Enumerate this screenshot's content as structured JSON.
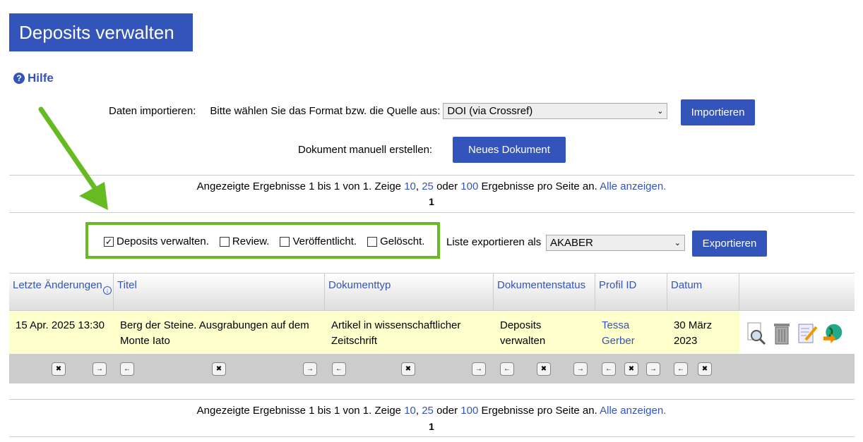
{
  "page_title": "Deposits verwalten",
  "help_label": "Hilfe",
  "import": {
    "label": "Daten importieren:",
    "select_label": "Bitte wählen Sie das Format bzw. die Quelle aus:",
    "select_value": "DOI (via Crossref)",
    "button": "Importieren"
  },
  "manual": {
    "label": "Dokument manuell erstellen:",
    "button": "Neues Dokument"
  },
  "results": {
    "prefix": "Angezeigte Ergebnisse 1 bis 1 von 1. Zeige",
    "opt10": "10",
    "sep1": ",",
    "opt25": "25",
    "oder": "oder",
    "opt100": "100",
    "suffix": "Ergebnisse pro Seite an.",
    "all": "Alle anzeigen.",
    "page": "1"
  },
  "filters": [
    {
      "label": "Deposits verwalten.",
      "checked": true
    },
    {
      "label": "Review.",
      "checked": false
    },
    {
      "label": "Veröffentlicht.",
      "checked": false
    },
    {
      "label": "Gelöscht.",
      "checked": false
    }
  ],
  "export": {
    "label": "Liste exportieren als",
    "select_value": "AKABER",
    "button": "Exportieren"
  },
  "table": {
    "headers": [
      "Letzte Änderungen",
      "Titel",
      "Dokumenttyp",
      "Dokumentenstatus",
      "Profil ID",
      "Datum"
    ],
    "row": {
      "changed": "15 Apr. 2025 13:30",
      "title": "Berg der Steine. Ausgrabungen auf dem Monte Iato",
      "type": "Artikel in wissenschaftlicher Zeitschrift",
      "status": "Deposits verwalten",
      "profile": "Tessa Gerber",
      "date": "30 März 2023"
    }
  },
  "colors": {
    "accent": "#3355bb",
    "highlight": "#66bb22",
    "row_bg": "#ffffcc"
  },
  "icons": [
    "view-icon",
    "trash-icon",
    "edit-icon",
    "export-globe-icon"
  ]
}
